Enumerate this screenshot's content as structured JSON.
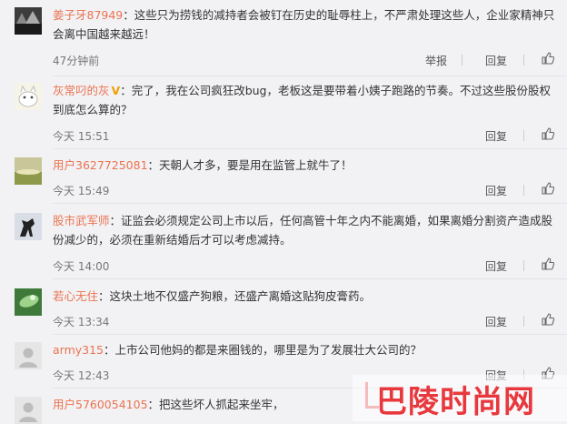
{
  "comments": [
    {
      "user": "姜子牙87949",
      "text": "：这些只为捞钱的减持者会被钉在历史的耻辱柱上，不严肃处理这些人，企业家精神只会离中国越来越远！",
      "time": "47分钟前",
      "report": "举报",
      "reply": "回复"
    },
    {
      "user": "灰常叼的灰",
      "badge": "V",
      "text": "：完了，我在公司疯狂改bug，老板这是要带着小姨子跑路的节奏。不过这些股份股权到底怎么算的？",
      "time": "今天 15:51",
      "reply": "回复"
    },
    {
      "user": "用户3627725081",
      "text": "：天朝人才多，要是用在监管上就牛了！",
      "time": "今天 15:49",
      "reply": "回复"
    },
    {
      "user": "股市武军师",
      "text": "：证监会必须规定公司上市以后，任何高管十年之内不能离婚，如果离婚分割资产造成股份减少的，必须在重新结婚后才可以考虑减持。",
      "time": "今天 14:00",
      "reply": "回复"
    },
    {
      "user": "若心无住",
      "text": "：这块土地不仅盛产狗粮，还盛产离婚这贴狗皮膏药。",
      "time": "今天 13:34",
      "reply": "回复"
    },
    {
      "user": "army315",
      "text": "：上市公司他妈的都是来圈钱的，哪里是为了发展壮大公司的？",
      "time": "今天 12:43",
      "reply": "回复"
    },
    {
      "user": "用户5760054105",
      "text": "：把这些坏人抓起来坐牢，",
      "time": "",
      "reply": ""
    }
  ],
  "watermark": "巴陵时尚网",
  "colors": {
    "username": "#eb7350",
    "badge": "#f1a000",
    "watermark": "#e8383d"
  }
}
